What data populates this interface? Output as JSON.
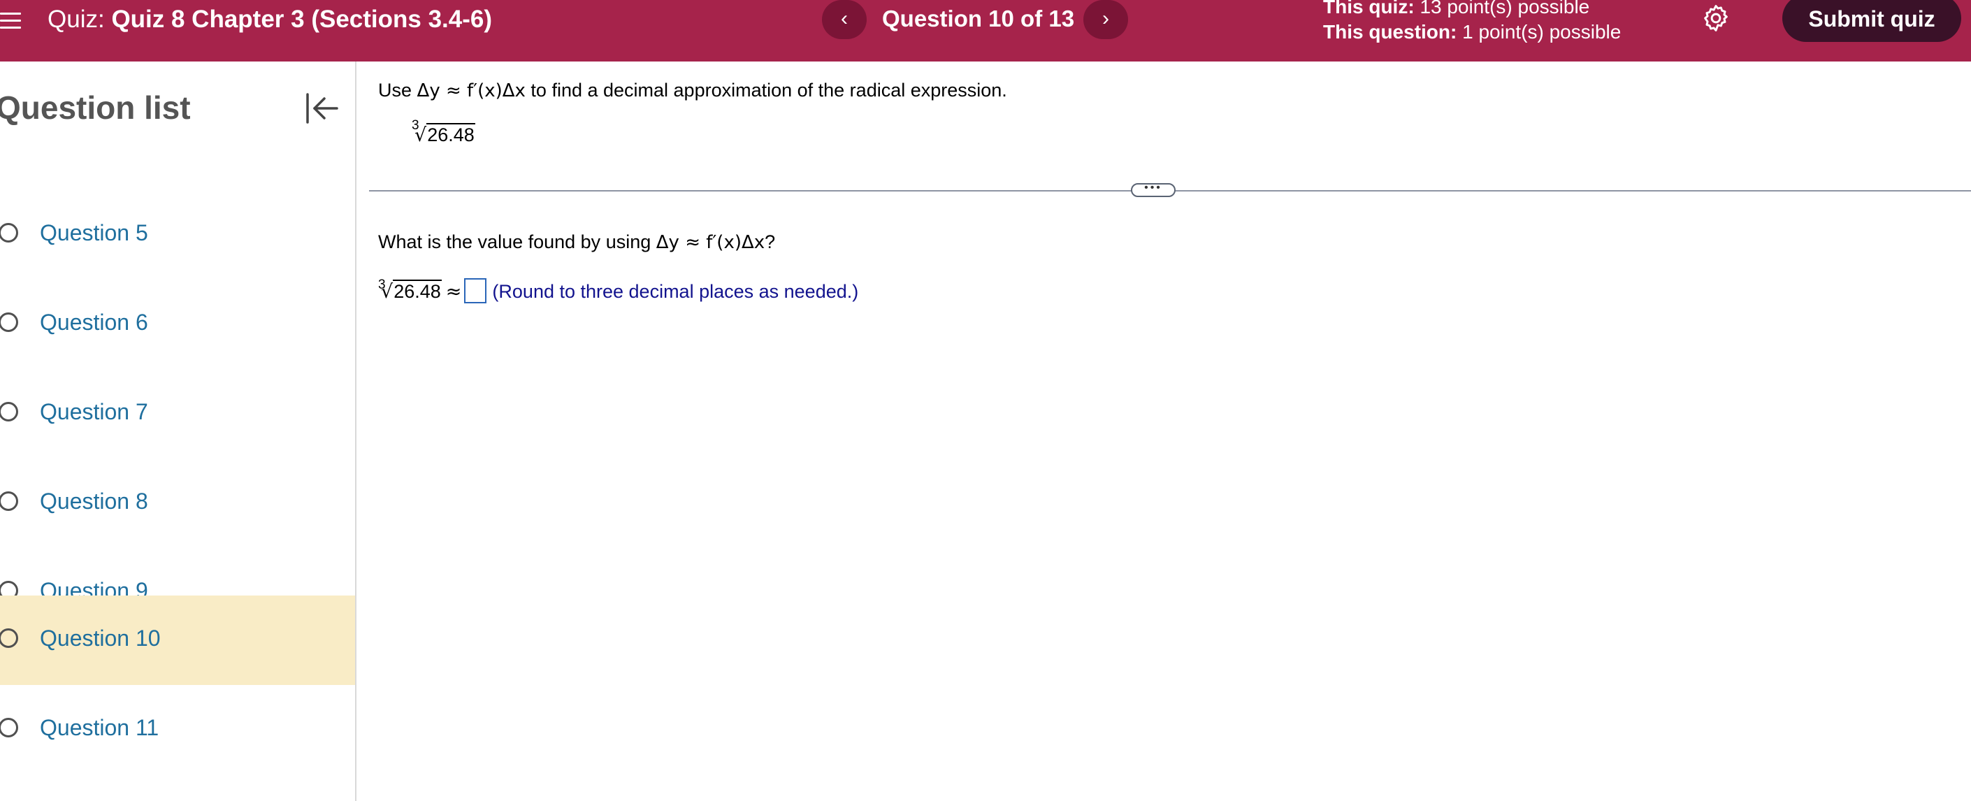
{
  "header": {
    "quiz_label": "Quiz:",
    "quiz_name": "Quiz 8 Chapter 3 (Sections 3.4-6)",
    "prev_icon": "‹",
    "next_icon": "›",
    "question_counter": "Question 10 of 13",
    "quiz_points_label": "This quiz:",
    "quiz_points_value": "13 point(s) possible",
    "question_points_label": "This question:",
    "question_points_value": "1 point(s) possible",
    "submit_label": "Submit quiz"
  },
  "sidebar": {
    "title": "Question list",
    "items": [
      {
        "label": "Question 5"
      },
      {
        "label": "Question 6"
      },
      {
        "label": "Question 7"
      },
      {
        "label": "Question 8"
      },
      {
        "label": "Question 9"
      },
      {
        "label": "Question 10",
        "active": true
      },
      {
        "label": "Question 11"
      }
    ]
  },
  "main": {
    "stmt_pre": "Use ",
    "stmt_formula": "Δy ≈ f′(x)Δx",
    "stmt_post": " to find a decimal approximation of the radical expression.",
    "radical_index": "3",
    "radical_sign": "√",
    "radicand": "26.48",
    "question_pre": "What is the value found by using ",
    "question_formula": "Δy ≈ f′(x)Δx",
    "question_post": "?",
    "approx_symbol": "≈",
    "answer_value": "",
    "hint": "(Round to three decimal places as needed.)",
    "drag_handle_text": "•••"
  },
  "colors": {
    "header_bg": "#a6234b",
    "submit_bg": "#3a1128",
    "nav_btn_bg": "#7b1436",
    "active_item_bg": "#f9ecc6",
    "link_blue": "#1f6f9e",
    "hint_blue": "#12138e"
  },
  "icons": {
    "menu": "hamburger-menu-icon",
    "prev": "chevron-left-icon",
    "next": "chevron-right-icon",
    "settings": "gear-icon",
    "collapse": "collapse-left-icon",
    "status": "circle-outline-icon"
  }
}
